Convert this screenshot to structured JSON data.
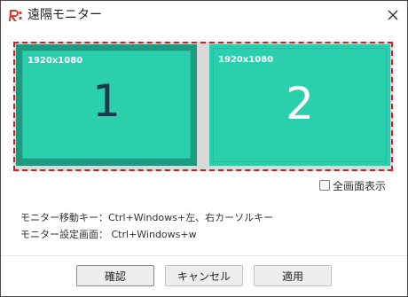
{
  "window": {
    "title": "遠隔モニター",
    "logo_icon": "rc-logo-icon",
    "logo_color": "#e23b2e"
  },
  "monitors": [
    {
      "resolution": "1920x1080",
      "number": "1",
      "selected": true
    },
    {
      "resolution": "1920x1080",
      "number": "2",
      "selected": false
    }
  ],
  "colors": {
    "monitor": "#2ad0ad",
    "monitor_selected_frame": "#1f9a80",
    "selection_dash": "#cf1f1f"
  },
  "options": {
    "fullscreen_label": "全画面表示",
    "fullscreen_checked": false
  },
  "hints": {
    "move_key": "モニター移動キー：Ctrl+Windows+左、右カーソルキー",
    "settings_screen": "モニター設定画面： Ctrl+Windows+w"
  },
  "buttons": {
    "confirm": "確認",
    "cancel": "キャンセル",
    "apply": "適用"
  }
}
